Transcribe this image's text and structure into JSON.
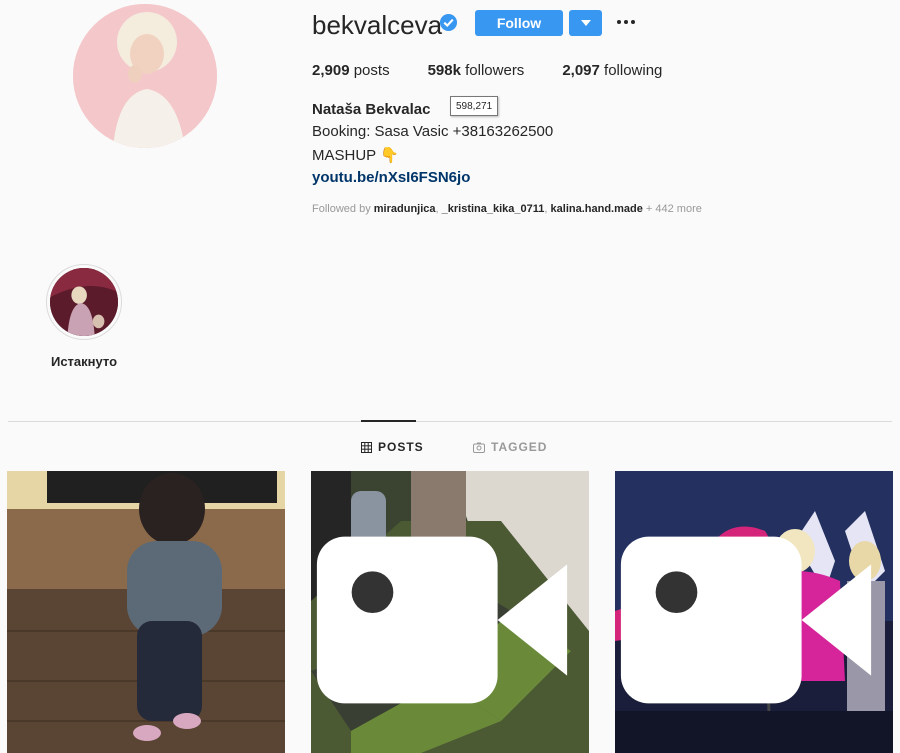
{
  "profile": {
    "username": "bekvalceva",
    "follow_label": "Follow",
    "posts_count": "2,909",
    "posts_label": "posts",
    "followers_count": "598k",
    "followers_label": "followers",
    "following_count": "2,097",
    "following_label": "following",
    "full_name": "Nataša Bekvalac",
    "followers_tooltip": "598,271",
    "bio_line1": "Booking: Sasa Vasic +38163262500",
    "bio_line2": "MASHUP 👇",
    "link": "youtu.be/nXsI6FSN6jo",
    "followed_by_prefix": "Followed by ",
    "followed_by_users": [
      "miradunjica",
      "_kristina_kika_0711",
      "kalina.hand.made"
    ],
    "followed_by_more": " + 442 more"
  },
  "highlights": [
    {
      "label": "Истакнуто"
    }
  ],
  "tabs": [
    {
      "label": "POSTS",
      "icon": "grid-icon",
      "active": true
    },
    {
      "label": "TAGGED",
      "icon": "tag-icon",
      "active": false
    }
  ],
  "posts": [
    {
      "icon": "",
      "description": "child-photo"
    },
    {
      "icon": "video-icon",
      "description": "hallway-photo"
    },
    {
      "icon": "video-icon",
      "description": "stage-photo"
    }
  ],
  "colors": {
    "accent": "#3897f0",
    "link": "#003569",
    "text": "#262626",
    "muted": "#999999",
    "background": "#fafafa"
  }
}
